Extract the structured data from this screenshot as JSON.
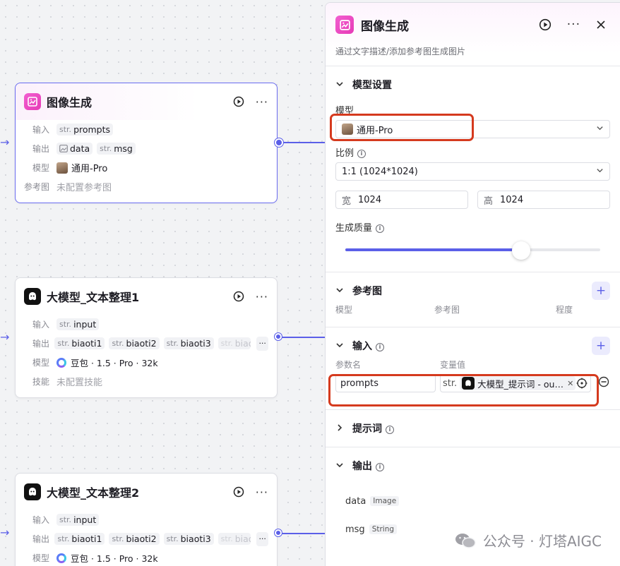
{
  "canvas": {
    "nodes": [
      {
        "title": "图像生成",
        "icon": "image-gen-icon",
        "rows": {
          "input_label": "输入",
          "input_vars": [
            {
              "type": "str.",
              "name": "prompts"
            }
          ],
          "output_label": "输出",
          "output_vars": [
            {
              "type": "img",
              "name": "data"
            },
            {
              "type": "str.",
              "name": "msg"
            }
          ],
          "model_label": "模型",
          "model_value": "通用-Pro",
          "ref_label": "参考图",
          "ref_value": "未配置参考图"
        }
      },
      {
        "title": "大模型_文本整理1",
        "icon": "llm-icon",
        "rows": {
          "input_label": "输入",
          "input_vars": [
            {
              "type": "str.",
              "name": "input"
            }
          ],
          "output_label": "输出",
          "output_vars": [
            {
              "type": "str.",
              "name": "biaoti1"
            },
            {
              "type": "str.",
              "name": "biaoti2"
            },
            {
              "type": "str.",
              "name": "biaoti3"
            },
            {
              "type": "str.",
              "name": "biao"
            }
          ],
          "model_label": "模型",
          "model_value": "豆包 · 1.5 · Pro · 32k",
          "skill_label": "技能",
          "skill_value": "未配置技能"
        }
      },
      {
        "title": "大模型_文本整理2",
        "icon": "llm-icon",
        "rows": {
          "input_label": "输入",
          "input_vars": [
            {
              "type": "str.",
              "name": "input"
            }
          ],
          "output_label": "输出",
          "output_vars": [
            {
              "type": "str.",
              "name": "biaoti1"
            },
            {
              "type": "str.",
              "name": "biaoti2"
            },
            {
              "type": "str.",
              "name": "biaoti3"
            },
            {
              "type": "str.",
              "name": "biao"
            }
          ],
          "model_label": "模型",
          "model_value": "豆包 · 1.5 · Pro · 32k"
        }
      }
    ]
  },
  "panel": {
    "title": "图像生成",
    "description": "通过文字描述/添加参考图生成图片",
    "model_settings": {
      "title": "模型设置",
      "model_label": "模型",
      "model_value": "通用-Pro",
      "ratio_label": "比例",
      "ratio_value": "1:1 (1024*1024)",
      "width_label": "宽",
      "width_value": "1024",
      "height_label": "高",
      "height_value": "1024",
      "quality_label": "生成质量",
      "quality_fraction": 0.69
    },
    "reference": {
      "title": "参考图",
      "col_model": "模型",
      "col_ref": "参考图",
      "col_degree": "程度"
    },
    "input": {
      "title": "输入",
      "col_param": "参数名",
      "col_value": "变量值",
      "param_name": "prompts",
      "var_type": "str.",
      "var_ref": "大模型_提示词 - output"
    },
    "prompt": {
      "title": "提示词"
    },
    "output": {
      "title": "输出",
      "items": [
        {
          "name": "data",
          "type": "Image"
        },
        {
          "name": "msg",
          "type": "String"
        }
      ]
    }
  },
  "watermark": "公众号 · 灯塔AIGC",
  "colors": {
    "accent": "#5b5fe8",
    "highlight": "#d53a1e",
    "brand_pink": "#e63ab6"
  }
}
